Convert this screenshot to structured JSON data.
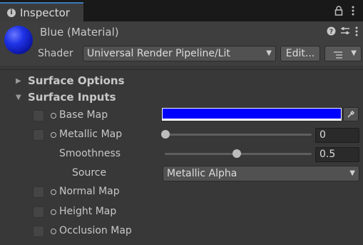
{
  "tab": {
    "label": "Inspector",
    "icon": "info-icon"
  },
  "toolbar": {
    "lock_icon": "lock-icon",
    "menu_icon": "kebab-menu-icon"
  },
  "material": {
    "title": "Blue (Material)",
    "preview_color": "#1f33e6",
    "icons": [
      "help-icon",
      "preset-icon",
      "kebab-menu-icon"
    ],
    "shader_label": "Shader",
    "shader_value": "Universal Render Pipeline/Lit",
    "edit_label": "Edit...",
    "list_icon": "list-icon"
  },
  "sections": {
    "surface_options": "Surface Options",
    "surface_inputs": "Surface Inputs"
  },
  "properties": {
    "base_map": {
      "label": "Base Map",
      "color": "#0000ff"
    },
    "metallic_map": {
      "label": "Metallic Map",
      "value": "0",
      "slider": 0.0
    },
    "smoothness": {
      "label": "Smoothness",
      "value": "0.5",
      "slider": 0.5
    },
    "source": {
      "label": "Source",
      "value": "Metallic Alpha"
    },
    "normal_map": {
      "label": "Normal Map"
    },
    "height_map": {
      "label": "Height Map"
    },
    "occlusion_map": {
      "label": "Occlusion Map"
    }
  },
  "colors": {
    "accent": "#3a79bb",
    "background": "#383838"
  }
}
